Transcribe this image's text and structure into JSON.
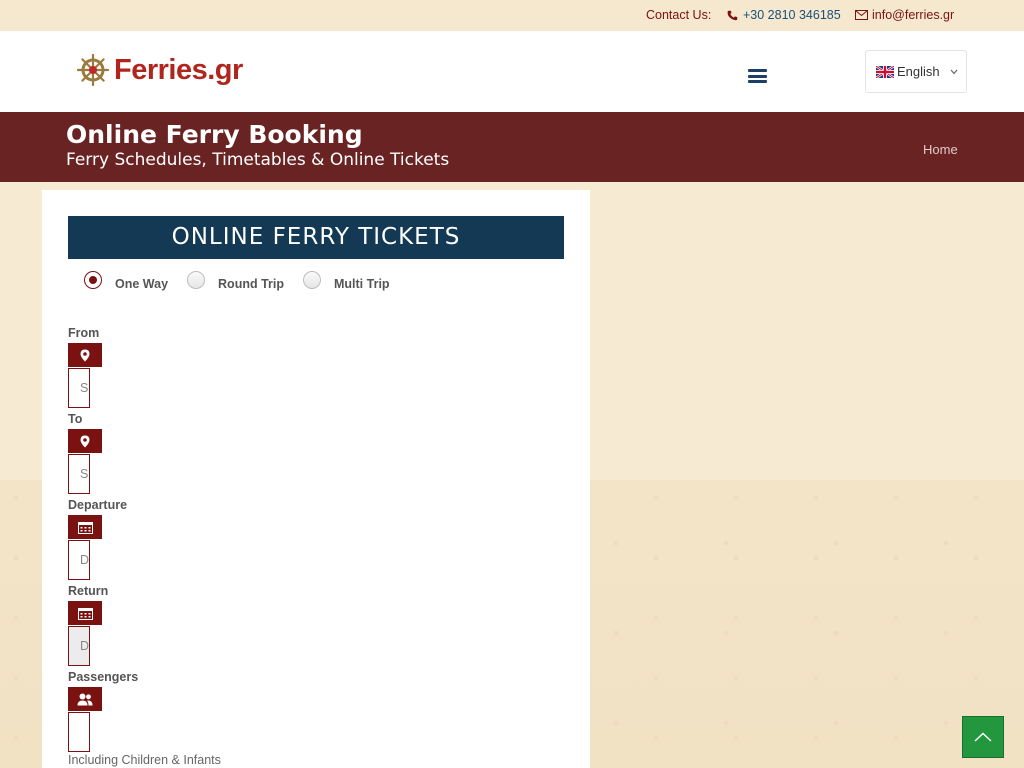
{
  "topbar": {
    "contact_label": "Contact Us:",
    "phone": "+30 2810 346185",
    "email": "info@ferries.gr"
  },
  "header": {
    "logo_text": "Ferries.gr",
    "language": "English"
  },
  "banner": {
    "title": "Online Ferry Booking",
    "subtitle": "Ferry Schedules, Timetables & Online Tickets",
    "breadcrumb_home": "Home"
  },
  "booking": {
    "heading": "ONLINE FERRY TICKETS",
    "trip_types": [
      {
        "label": "One Way",
        "selected": true
      },
      {
        "label": "Round Trip",
        "selected": false
      },
      {
        "label": "Multi Trip",
        "selected": false
      }
    ],
    "from": {
      "label": "From",
      "value": "S"
    },
    "to": {
      "label": "To",
      "value": "S"
    },
    "departure": {
      "label": "Departure",
      "value": "D"
    },
    "return": {
      "label": "Return",
      "value": "D"
    },
    "passengers": {
      "label": "Passengers",
      "value": ""
    },
    "passengers_note": "Including Children & Infants"
  },
  "colors": {
    "brand": "#b0261f",
    "banner": "#6a2323",
    "heading_bg": "#133954",
    "accent": "#7a1212",
    "back_to_top": "#22973d"
  },
  "icons": {
    "phone": "phone-icon",
    "email": "envelope-icon",
    "menu": "hamburger-menu-icon",
    "location": "map-marker-icon",
    "calendar": "calendar-icon",
    "passengers": "users-icon",
    "back_to_top": "chevron-up-icon"
  }
}
